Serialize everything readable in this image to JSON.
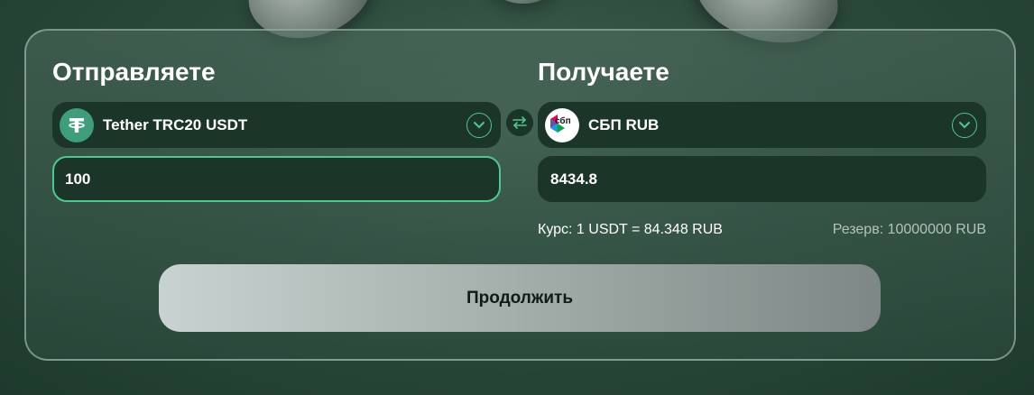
{
  "send": {
    "title": "Отправляете",
    "currency_label": "Tether TRC20 USDT",
    "currency_icon": "tether-icon",
    "amount": "100"
  },
  "receive": {
    "title": "Получаете",
    "currency_label": "СБП RUB",
    "currency_icon": "sbp-icon",
    "icon_text": "сбп",
    "amount": "8434.8"
  },
  "rate_text": "Курс: 1 USDT = 84.348 RUB",
  "reserve_text": "Резерв: 10000000 RUB",
  "continue_label": "Продолжить",
  "colors": {
    "accent": "#4fc88f",
    "field_bg": "#1c3529",
    "tether": "#3f9d7b"
  }
}
